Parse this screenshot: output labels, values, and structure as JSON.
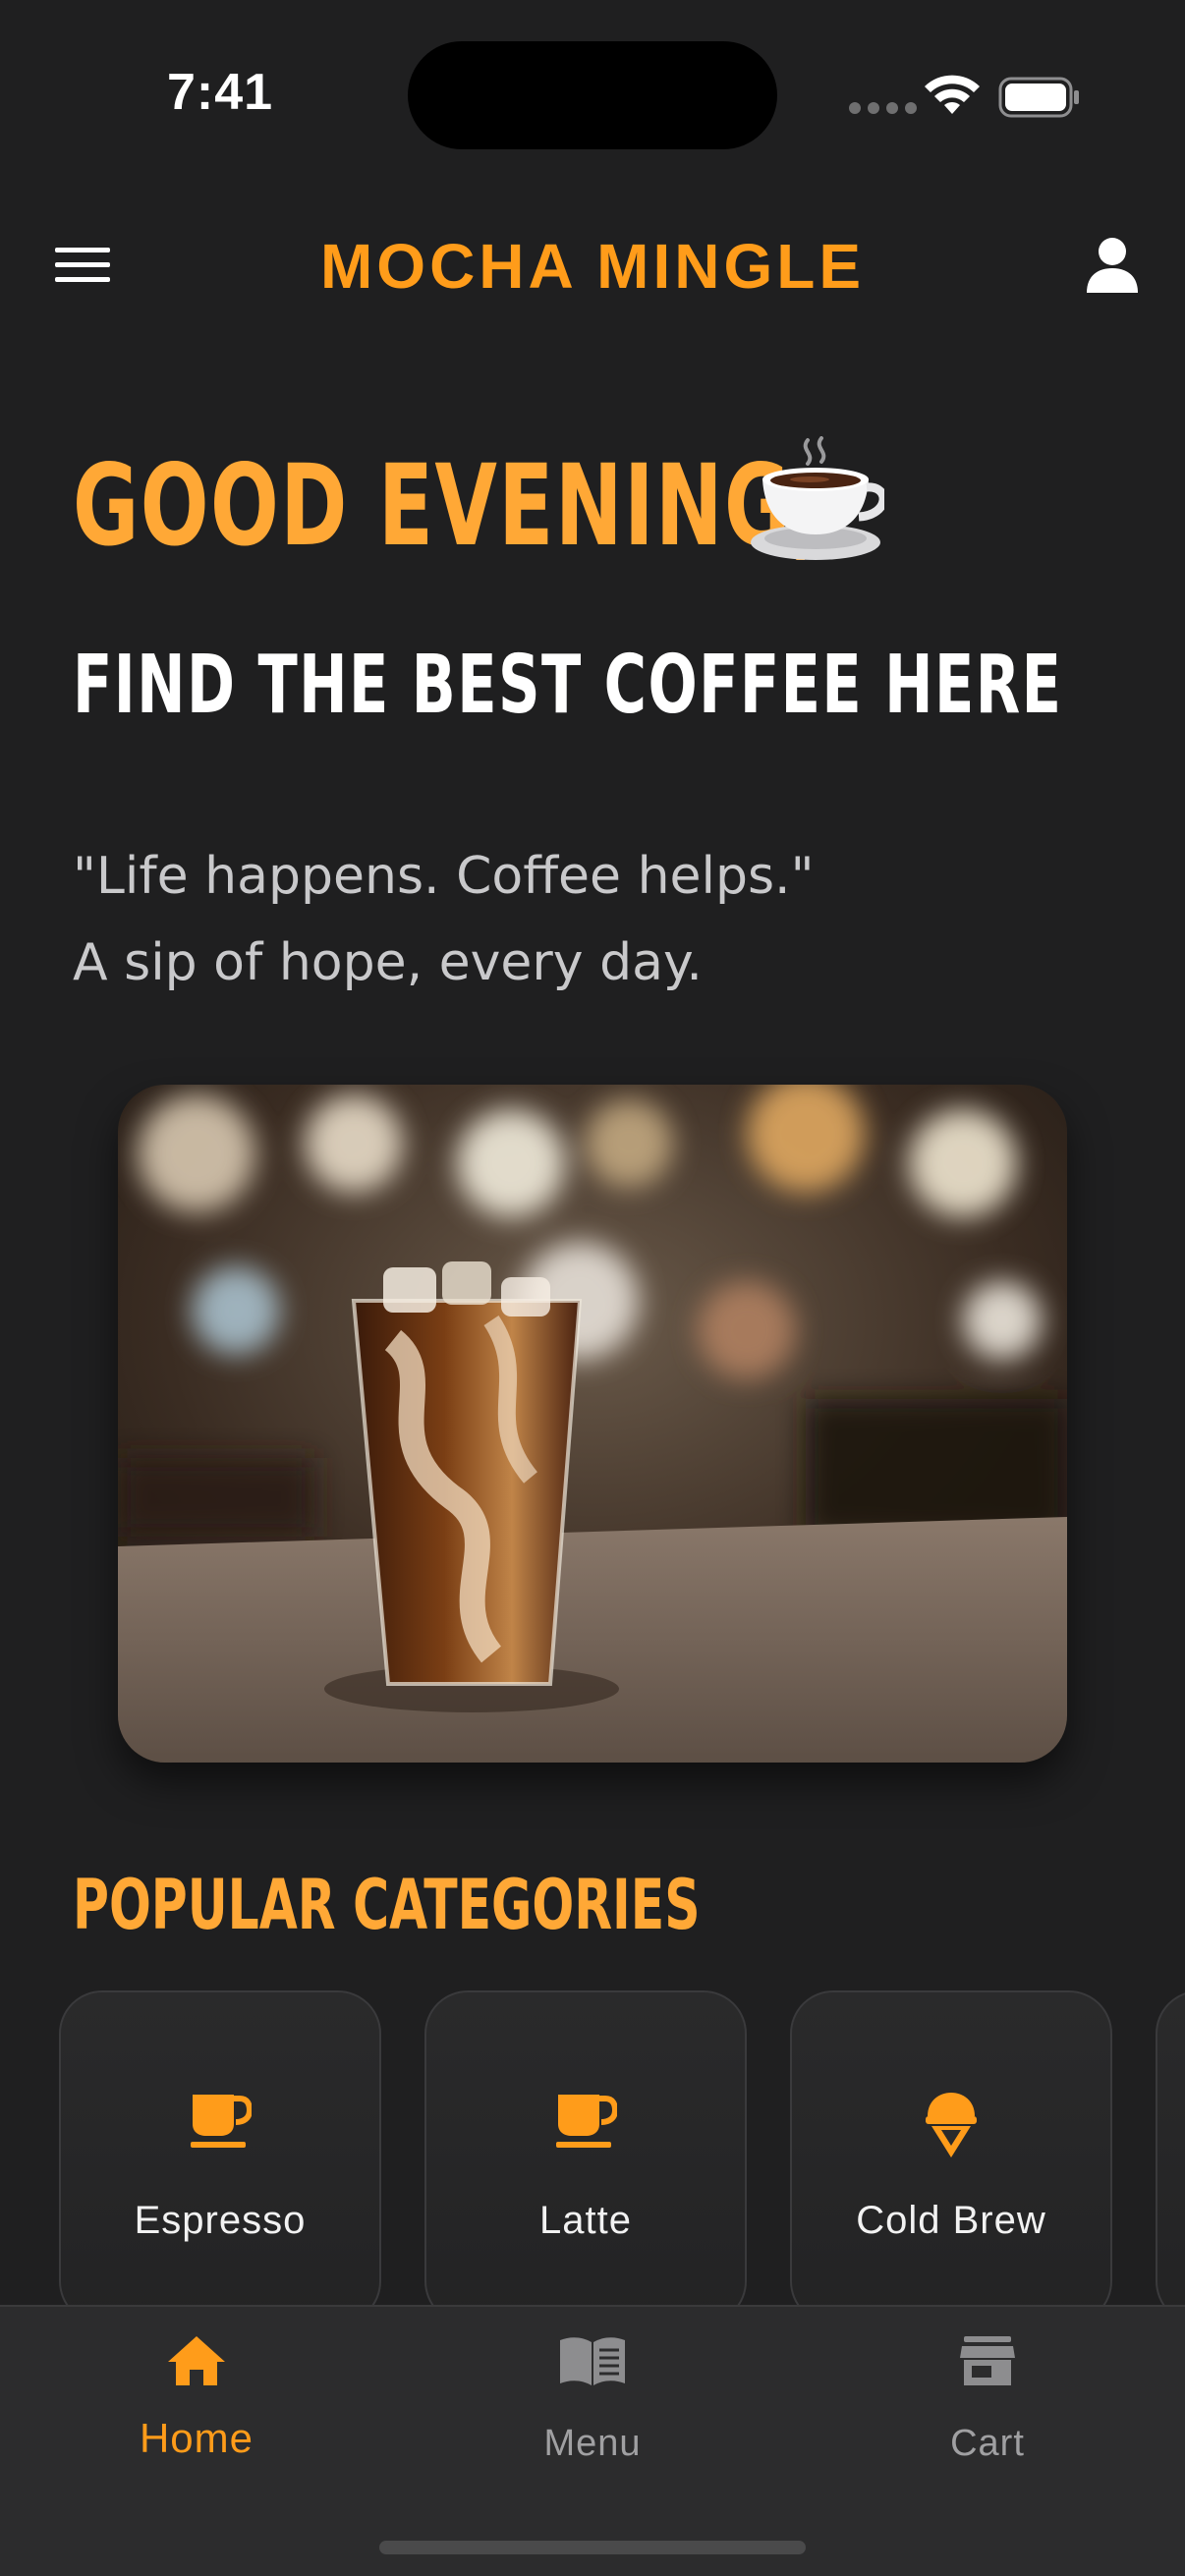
{
  "status_bar": {
    "time": "7:41"
  },
  "app_bar": {
    "title": "MOCHA MINGLE"
  },
  "hero": {
    "greeting": "GOOD EVENING,",
    "subheading": "FIND THE BEST COFFEE HERE",
    "quote_line_1": "\"Life happens. Coffee helps.\"",
    "quote_line_2": "A sip of hope, every day."
  },
  "categories": {
    "title": "POPULAR CATEGORIES",
    "items": [
      {
        "label": "Espresso",
        "icon": "coffee-cup-icon"
      },
      {
        "label": "Latte",
        "icon": "coffee-cup-icon"
      },
      {
        "label": "Cold Brew",
        "icon": "ice-cream-icon"
      }
    ]
  },
  "bottom_nav": {
    "items": [
      {
        "label": "Home",
        "icon": "home-icon",
        "active": true
      },
      {
        "label": "Menu",
        "icon": "book-icon",
        "active": false
      },
      {
        "label": "Cart",
        "icon": "store-icon",
        "active": false
      }
    ]
  },
  "colors": {
    "accent": "#ff9c1a",
    "background": "#1f1f20",
    "nav_background": "#2c2c2d",
    "inactive": "#a0a0a2"
  }
}
